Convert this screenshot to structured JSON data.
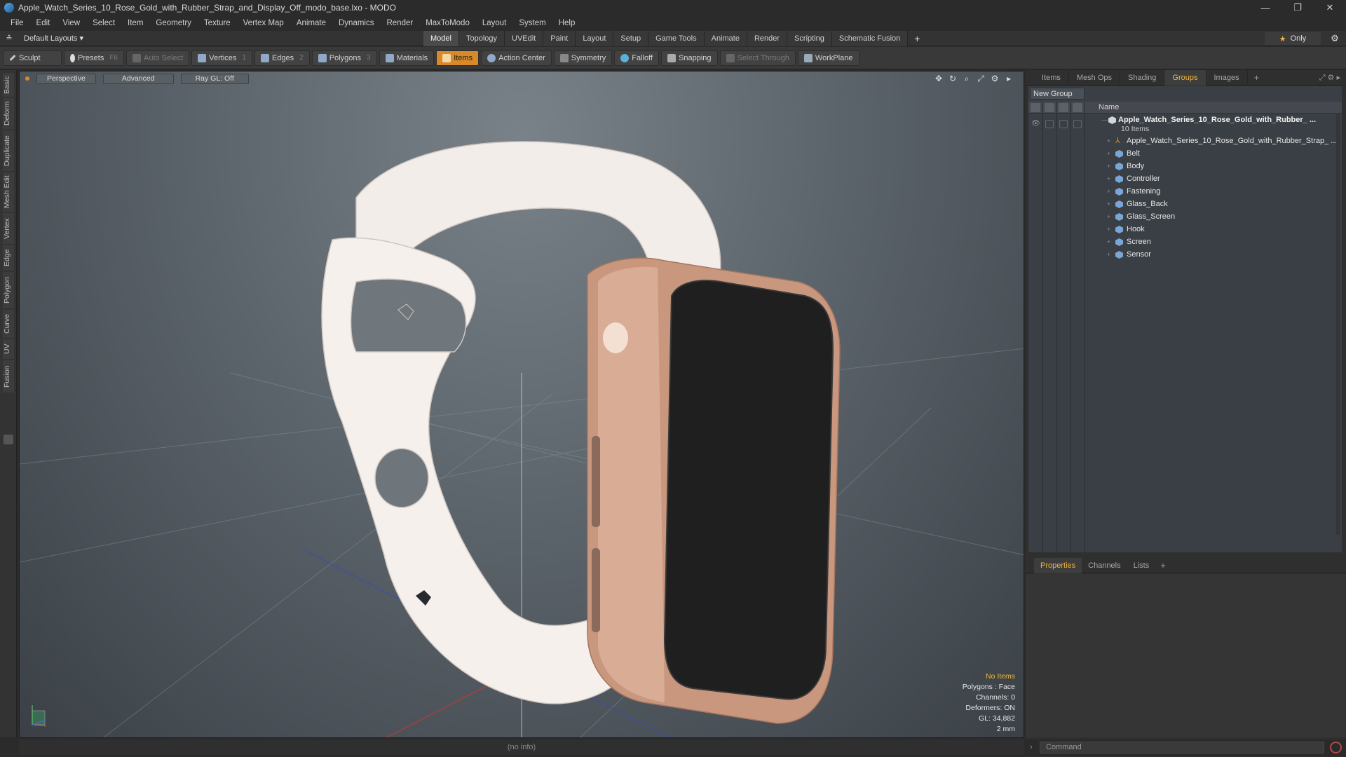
{
  "window": {
    "title": "Apple_Watch_Series_10_Rose_Gold_with_Rubber_Strap_and_Display_Off_modo_base.lxo - MODO",
    "controls": [
      "—",
      "❐",
      "✕"
    ]
  },
  "menu": [
    "File",
    "Edit",
    "View",
    "Select",
    "Item",
    "Geometry",
    "Texture",
    "Vertex Map",
    "Animate",
    "Dynamics",
    "Render",
    "MaxToModo",
    "Layout",
    "System",
    "Help"
  ],
  "layoutbar": {
    "layout_select": "Default Layouts ▾",
    "tabs": [
      "Model",
      "Topology",
      "UVEdit",
      "Paint",
      "Layout",
      "Setup",
      "Game Tools",
      "Animate",
      "Render",
      "Scripting",
      "Schematic Fusion"
    ],
    "active_tab": "Model",
    "add_tab": "+",
    "only_label": "Only",
    "only_icon": "star-icon",
    "settings_icon": "gear-icon"
  },
  "toolbar": {
    "sculpt": "Sculpt",
    "presets": "Presets",
    "presets_key": "F6",
    "auto_select": "Auto Select",
    "vertices": "Vertices",
    "vertices_key": "1",
    "edges": "Edges",
    "edges_key": "2",
    "polygons": "Polygons",
    "polygons_key": "3",
    "materials": "Materials",
    "items": "Items",
    "action_center": "Action Center",
    "symmetry": "Symmetry",
    "falloff": "Falloff",
    "snapping": "Snapping",
    "select_through": "Select Through",
    "workplane": "WorkPlane"
  },
  "left_tabs": [
    "Basic",
    "Deform",
    "Duplicate",
    "Mesh Edit",
    "Vertex",
    "Edge",
    "Polygon",
    "Curve",
    "UV",
    "Fusion"
  ],
  "viewport": {
    "view_mode": "Perspective",
    "shading": "Advanced",
    "raygl": "Ray GL: Off",
    "info": {
      "selection": "No Items",
      "polygons": "Polygons : Face",
      "channels": "Channels: 0",
      "deformers": "Deformers: ON",
      "gl": "GL: 34,882",
      "scale": "2 mm"
    },
    "status": "(no info)"
  },
  "right_panel": {
    "tabs": [
      "Items",
      "Mesh Ops",
      "Shading",
      "Groups",
      "Images"
    ],
    "active_tab": "Groups",
    "new_group": "New Group",
    "name_header": "Name",
    "group": {
      "name": "Apple_Watch_Series_10_Rose_Gold_with_Rubber_ ...",
      "count": "10 Items"
    },
    "items": [
      "Apple_Watch_Series_10_Rose_Gold_with_Rubber_Strap_ ...",
      "Belt",
      "Body",
      "Controller",
      "Fastening",
      "Glass_Back",
      "Glass_Screen",
      "Hook",
      "Screen",
      "Sensor"
    ],
    "props_tabs": [
      "Properties",
      "Channels",
      "Lists"
    ],
    "props_active": "Properties",
    "command_placeholder": "Command"
  },
  "colors": {
    "accent": "#d88a28",
    "highlight_text": "#f0b73c",
    "watch_case": "#c9977e",
    "strap": "#efe7e2",
    "screen": "#1f1f1f"
  }
}
